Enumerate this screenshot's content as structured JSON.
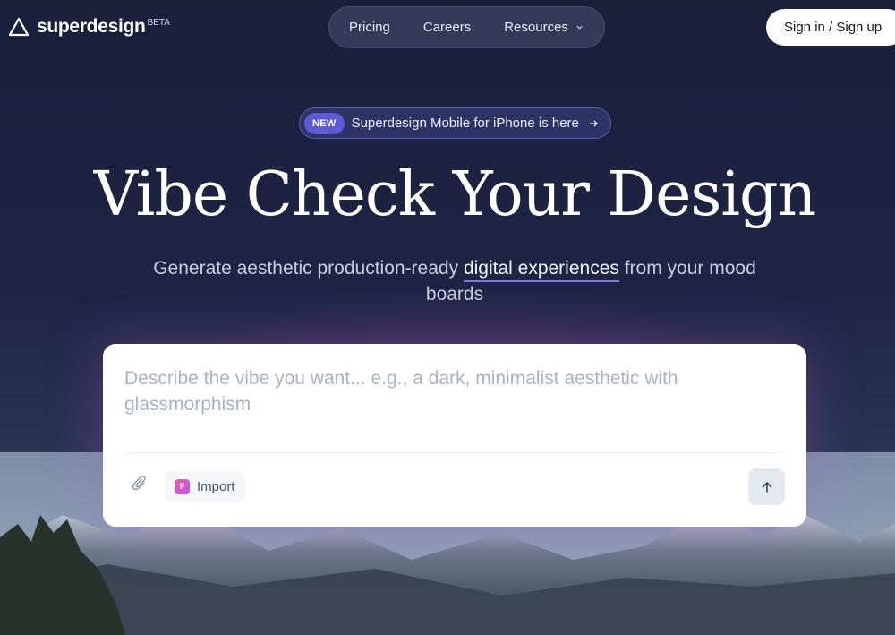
{
  "brand": {
    "name": "superdesign",
    "beta_label": "BETA",
    "icon": "triangle-logo-icon"
  },
  "nav": {
    "items": [
      {
        "label": "Pricing"
      },
      {
        "label": "Careers"
      },
      {
        "label": "Resources",
        "icon": "chevron-down-icon"
      }
    ]
  },
  "auth": {
    "signin_label": "Sign in / Sign up"
  },
  "announcement": {
    "badge": "NEW",
    "text": "Superdesign Mobile for iPhone is here",
    "icon": "arrow-right-icon"
  },
  "hero": {
    "title": "Vibe Check Your Design",
    "subtitle_before": "Generate aesthetic production-ready ",
    "subtitle_highlight": "digital experiences",
    "subtitle_after": "  from your mood boards"
  },
  "prompt_box": {
    "placeholder": "Describe the vibe you want... e.g., a dark, minimalist aesthetic with glassmorphism",
    "value": "",
    "attach_icon": "paperclip-icon",
    "import_label": "Import",
    "import_icon_letter": "F",
    "send_icon": "arrow-up-icon"
  },
  "colors": {
    "background": "#1d2340",
    "accent": "#5d5ad8",
    "highlight_underline": "#7b79ef",
    "card": "#ffffff"
  }
}
